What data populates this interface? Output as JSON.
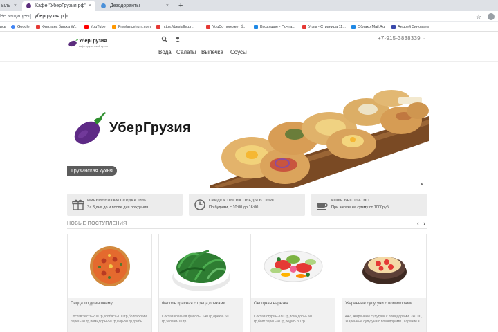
{
  "browser": {
    "tabs": [
      {
        "label": "ыль",
        "active": false
      },
      {
        "label": "Кафе \"УберГрузия.рф\"",
        "active": true
      },
      {
        "label": "Дезодоранты",
        "active": false
      }
    ],
    "new_tab_label": "+",
    "close_glyph": "×",
    "address": {
      "security_label": "Не защищено",
      "url": "убергрузия.рф"
    },
    "bookmarks": [
      {
        "label": "ись",
        "icon_color": "#9aa0a6"
      },
      {
        "label": "Google",
        "icon_color": "#4285f4"
      },
      {
        "label": "Фриланс биржа W...",
        "icon_color": "#e53935"
      },
      {
        "label": "YouTube",
        "icon_color": "#ff0000"
      },
      {
        "label": "Freelancehunt.com",
        "icon_color": "#ff9800"
      },
      {
        "label": "https://bestalle.pr...",
        "icon_color": "#e53935"
      },
      {
        "label": "YouDo поможет б...",
        "icon_color": "#e53935"
      },
      {
        "label": "Входящие - Почта...",
        "icon_color": "#1e88e5"
      },
      {
        "label": "Углы - Страница 11...",
        "icon_color": "#e53935"
      },
      {
        "label": "Облако Mail.Ru",
        "icon_color": "#1e88e5"
      },
      {
        "label": "Андрей Зиновьев",
        "icon_color": "#3949ab"
      }
    ]
  },
  "site": {
    "logo": {
      "name": "УберГрузия",
      "tagline": "кафе грузинской кухни"
    },
    "phone": "+7-915-3838339",
    "phone_chevron": "⌄",
    "nav": [
      "Вода",
      "Салаты",
      "Выпечка",
      "Соусы"
    ]
  },
  "hero": {
    "title": "УберГрузия",
    "badge": "Грузинская кухня"
  },
  "promos": [
    {
      "title": "ИМЕНИННИКАМ СКИДКА 15%",
      "subtitle": "За 3 дня до и после дня рождения",
      "icon": "gift-icon"
    },
    {
      "title": "СКИДКА 10% НА ОБЕДЫ В ОФИС",
      "subtitle": "По будням, с 10:00 до 16:00",
      "icon": "clock-icon"
    },
    {
      "title": "КОФЕ БЕСПЛАТНО",
      "subtitle": "При заказе на сумму от 1000руб",
      "icon": "coffee-cup-icon"
    }
  ],
  "new_arrivals": {
    "title": "НОВЫЕ ПОСТУПЛЕНИЯ",
    "prev": "‹",
    "next": "›",
    "products": [
      {
        "name": "Пицца по домашнему",
        "description": "Состав:тесто-200 гр,колбаса-100 гр,болгарский перец-50 гр,помидоры-50 гр,сыр-50 гр,грибы ...",
        "image": "pizza"
      },
      {
        "name": "Фасоль красная с греца,орехами",
        "description": "Состав:красная фасоль- 140 гр,орехи- 60 гр,зелени-10 гр...",
        "image": "green-beans"
      },
      {
        "name": "Овощная нарезка",
        "description": "Состав:огурцы-180 гр,помидоры- 60 гр,болг.перец-60 гр,редис- 30 гр...",
        "image": "vegetable-platter"
      },
      {
        "name": "Жаренные сулугуни с помидорами",
        "description": "447, Жаренные сулугуни с помидорами, 240.00, Жаренные сулугуни с помидорами , Горячие з...",
        "image": "fried-suluguni"
      }
    ]
  }
}
